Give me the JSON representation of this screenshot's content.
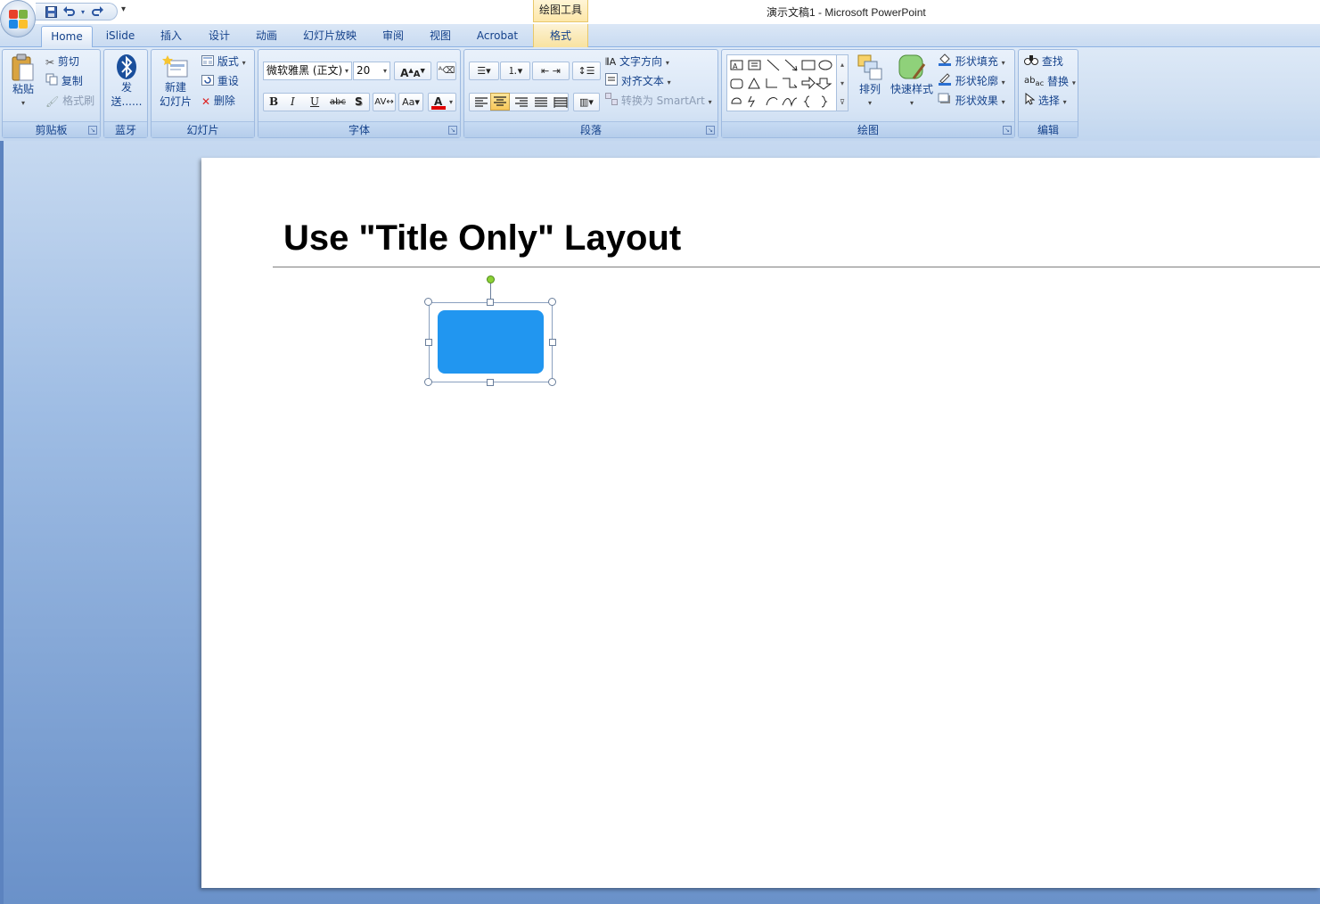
{
  "window": {
    "title": "演示文稿1 - Microsoft PowerPoint",
    "context_tab_label": "绘图工具"
  },
  "tabs": [
    {
      "label": "Home",
      "active": true
    },
    {
      "label": "iSlide"
    },
    {
      "label": "插入"
    },
    {
      "label": "设计"
    },
    {
      "label": "动画"
    },
    {
      "label": "幻灯片放映"
    },
    {
      "label": "审阅"
    },
    {
      "label": "视图"
    },
    {
      "label": "Acrobat"
    },
    {
      "label": "格式",
      "contextual": true
    }
  ],
  "ribbon": {
    "clipboard": {
      "label": "剪贴板",
      "paste": "粘贴",
      "cut": "剪切",
      "copy": "复制",
      "format_painter": "格式刷"
    },
    "bluetooth": {
      "label": "蓝牙",
      "send_line1": "发",
      "send_line2": "送......"
    },
    "slides": {
      "label": "幻灯片",
      "new_line1": "新建",
      "new_line2": "幻灯片",
      "layout": "版式",
      "reset": "重设",
      "delete": "删除"
    },
    "font": {
      "label": "字体",
      "font_name": "微软雅黑 (正文)",
      "font_size": "20"
    },
    "paragraph": {
      "label": "段落",
      "text_direction": "文字方向",
      "align_text": "对齐文本",
      "smartart": "转换为 SmartArt"
    },
    "drawing": {
      "label": "绘图",
      "arrange": "排列",
      "quick_styles": "快速样式",
      "shape_fill": "形状填充",
      "shape_outline": "形状轮廓",
      "shape_effects": "形状效果"
    },
    "editing": {
      "label": "编辑",
      "find": "查找",
      "replace": "替换",
      "select": "选择"
    }
  },
  "slide": {
    "title": "Use \"Title Only\" Layout",
    "shape_color": "#2196f0"
  },
  "colors": {
    "accent": "#15428b",
    "ribbon_bg": "#cfdff2",
    "font_color_bar": "#e00000"
  }
}
